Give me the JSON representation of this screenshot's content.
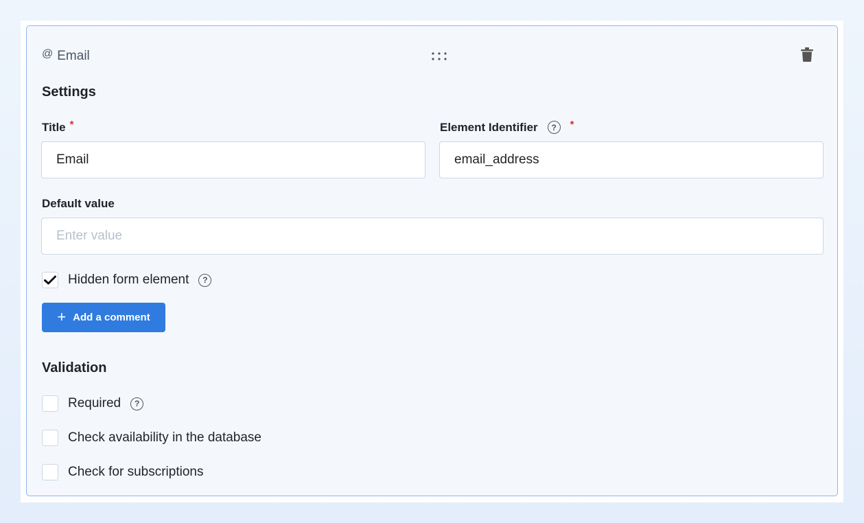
{
  "element": {
    "type_icon": "at-icon",
    "type_label": "Email",
    "drag_icon": "drag-handle-icon",
    "delete_icon": "trash-icon"
  },
  "settings": {
    "section_title": "Settings",
    "title_label": "Title",
    "title_value": "Email",
    "identifier_label": "Element Identifier",
    "identifier_value": "email_address",
    "required_marker": "*",
    "help_glyph": "?",
    "default_label": "Default value",
    "default_placeholder": "Enter value",
    "default_value": "",
    "hidden_label": "Hidden form element",
    "hidden_checked": true,
    "add_comment_plus": "+",
    "add_comment_label": "Add a comment"
  },
  "validation": {
    "section_title": "Validation",
    "options": [
      {
        "label": "Required",
        "checked": false,
        "has_help": true
      },
      {
        "label": "Check availability in the database",
        "checked": false,
        "has_help": false
      },
      {
        "label": "Check for subscriptions",
        "checked": false,
        "has_help": false
      }
    ]
  },
  "colors": {
    "accent": "#2f7be0",
    "card_border": "#8fb4ec",
    "required": "#d32f2f"
  }
}
